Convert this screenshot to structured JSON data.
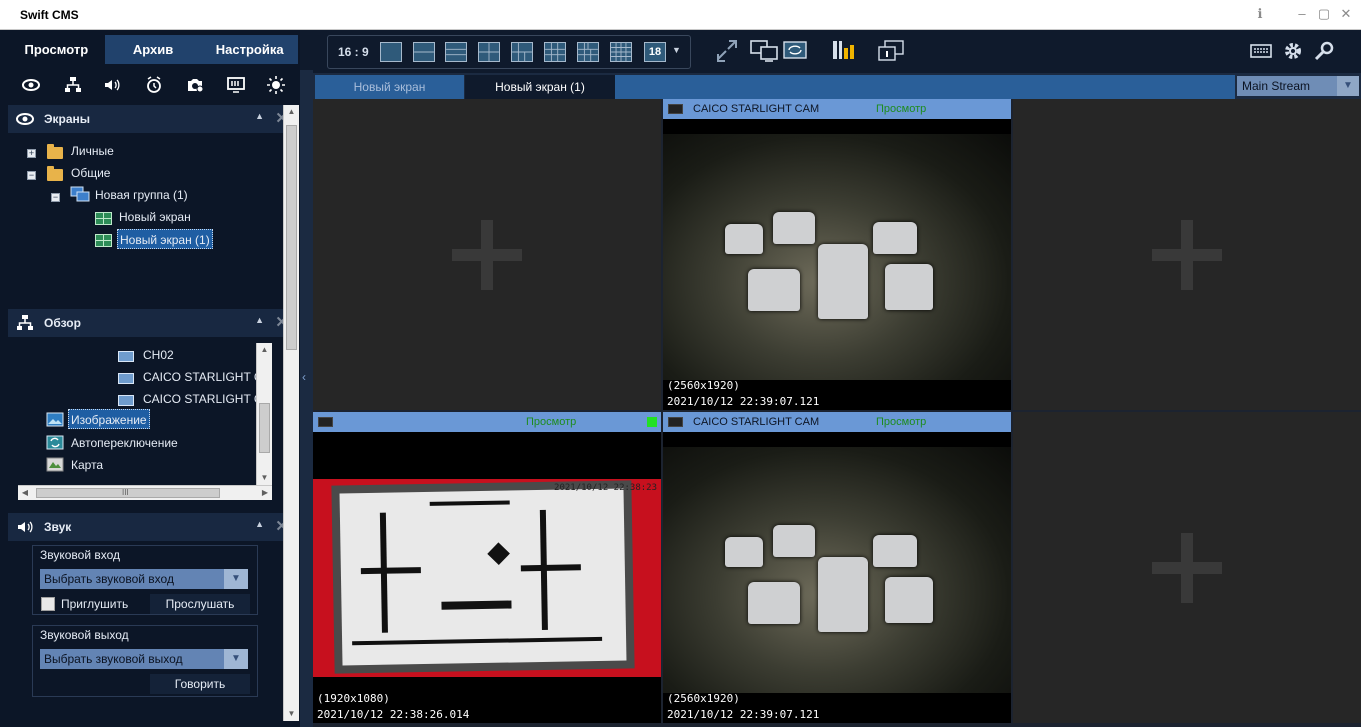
{
  "window": {
    "title": "Swift CMS",
    "controls": [
      "info-icon",
      "minimize-icon",
      "maximize-icon",
      "close-icon"
    ]
  },
  "tabs": [
    {
      "label": "Просмотр",
      "active": true
    },
    {
      "label": "Архив",
      "active": false
    },
    {
      "label": "Настройка",
      "active": false
    }
  ],
  "tool_icons": [
    "eye-icon",
    "network-icon",
    "speaker-icon",
    "alarm-icon",
    "camera-settings-icon",
    "monitor-icon",
    "brightness-icon"
  ],
  "screens_panel": {
    "title": "Экраны",
    "items": [
      {
        "label": "Личные",
        "type": "folder",
        "expander": "+"
      },
      {
        "label": "Общие",
        "type": "folder",
        "expander": "−"
      },
      {
        "label": "Новая группа (1)",
        "type": "group",
        "expander": "−"
      },
      {
        "label": "Новый экран",
        "type": "screen"
      },
      {
        "label": "Новый экран (1)",
        "type": "screen",
        "selected": true
      }
    ]
  },
  "overview_panel": {
    "title": "Обзор",
    "items": [
      {
        "label": "CH02",
        "type": "camera"
      },
      {
        "label": "CAICO STARLIGHT C",
        "type": "camera"
      },
      {
        "label": "CAICO STARLIGHT C",
        "type": "camera"
      },
      {
        "label": "Изображение",
        "type": "image",
        "selected": true
      },
      {
        "label": "Автопереключение",
        "type": "autoswitch"
      },
      {
        "label": "Карта",
        "type": "map"
      }
    ],
    "hscroll_label": "III"
  },
  "sound_panel": {
    "title": "Звук",
    "input": {
      "label": "Звуковой вход",
      "select_value": "Выбрать звуковой вход",
      "mute_label": "Приглушить",
      "listen_label": "Прослушать"
    },
    "output": {
      "label": "Звуковой выход",
      "select_value": "Выбрать звуковой выход",
      "talk_label": "Говорить"
    }
  },
  "toolbar": {
    "aspect_ratio": "16 : 9",
    "layout_count": "18"
  },
  "screen_tabs": [
    {
      "label": "Новый экран",
      "active": false
    },
    {
      "label": "Новый экран (1)",
      "active": true
    }
  ],
  "stream_select": {
    "value": "Main Stream"
  },
  "cells": [
    {
      "empty": true
    },
    {
      "name": "CAICO STARLIGHT CAM",
      "status": "Просмотр",
      "resolution": "(2560x1920)",
      "timestamp": "2021/10/12 22:39:07.121"
    },
    {
      "empty": true
    },
    {
      "name": "",
      "status": "Просмотр",
      "resolution": "(1920x1080)",
      "timestamp": "2021/10/12 22:38:26.014",
      "recording_indicator": true,
      "chart_timestamp": "2021/10/12 22:38:23"
    },
    {
      "name": "CAICO STARLIGHT CAM",
      "status": "Просмотр",
      "resolution": "(2560x1920)",
      "timestamp": "2021/10/12 22:39:07.121"
    },
    {
      "empty": true
    }
  ],
  "colors": {
    "accent": "#2a5f99",
    "status_green": "#23e023",
    "panel_bg": "#0c1627",
    "cam_header": "#6a98d6"
  }
}
